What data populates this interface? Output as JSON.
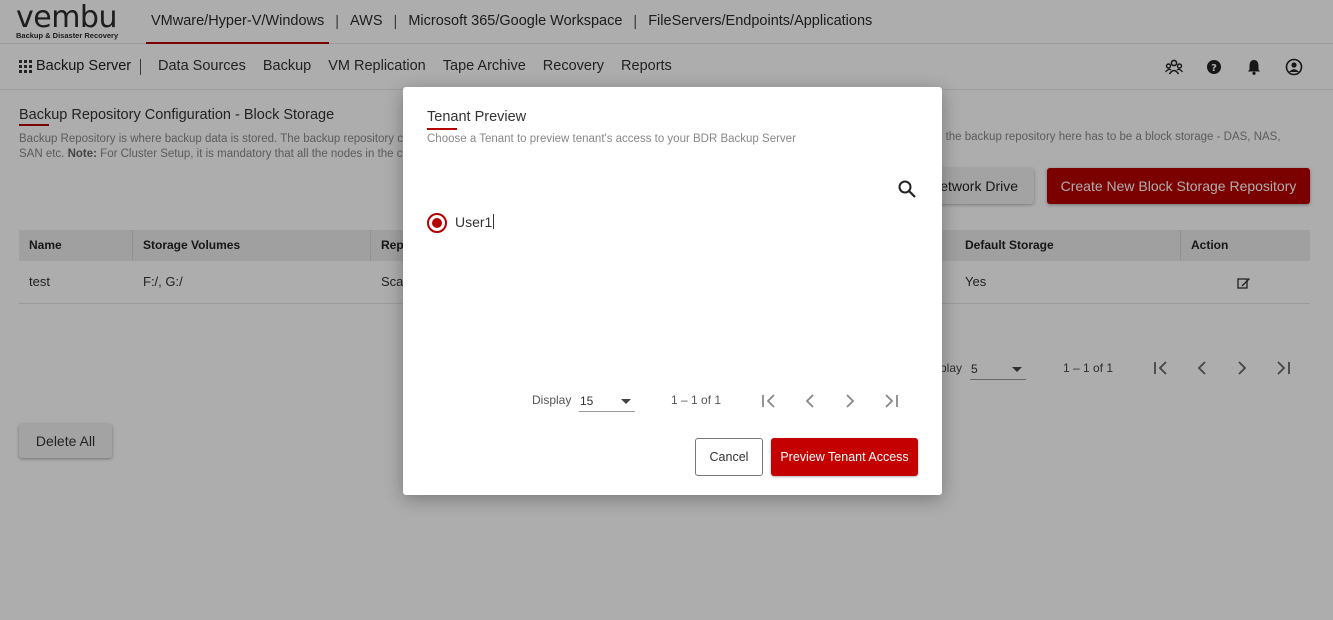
{
  "app": {
    "logo_text": "vembu",
    "logo_tagline": "Backup & Disaster Recovery"
  },
  "top_nav": {
    "items": [
      {
        "label": "VMware/Hyper-V/Windows",
        "active": true
      },
      {
        "label": "AWS"
      },
      {
        "label": "Microsoft 365/Google Workspace"
      },
      {
        "label": "FileServers/Endpoints/Applications"
      }
    ],
    "separator": "|"
  },
  "sub_nav": {
    "brand": "Backup Server",
    "items": [
      "Data Sources",
      "Backup",
      "VM Replication",
      "Tape Archive",
      "Recovery",
      "Reports"
    ],
    "icons": [
      "users-icon",
      "help-icon",
      "bell-icon",
      "user-profile-icon"
    ]
  },
  "page": {
    "title": "Backup Repository Configuration - Block Storage",
    "desc_line1": "Backup Repository is where backup data is stored. The backup repository c",
    "desc_line1_right": "eate the backup repository here has to be a block storage - DAS, NAS,",
    "desc_line2_prefix": "SAN etc. ",
    "desc_line2_bold": "Note:",
    "desc_line2_rest": " For Cluster Setup, it is mandatory that all the nodes in the c",
    "network_drive_button": "etwork Drive",
    "create_button": "Create New Block Storage Repository",
    "table": {
      "columns": [
        "Name",
        "Storage Volumes",
        "Repo",
        "Default Storage",
        "Action"
      ],
      "rows": [
        {
          "name": "test",
          "volumes": "F:/, G:/",
          "repo": "Scal",
          "default_storage": "Yes",
          "action_icon": "edit-icon"
        }
      ]
    },
    "pager": {
      "display_label": "play",
      "page_size": "5",
      "range": "1 – 1 of 1"
    },
    "delete_all_button": "Delete All"
  },
  "modal": {
    "title": "Tenant Preview",
    "subtitle": "Choose a Tenant to preview tenant's access to your BDR Backup Server",
    "search_icon": "search-icon",
    "tenants": [
      {
        "label": "User1",
        "selected": true
      }
    ],
    "pager": {
      "display_label": "Display",
      "page_size": "15",
      "range": "1 – 1 of 1"
    },
    "cancel_button": "Cancel",
    "preview_button": "Preview Tenant Access"
  },
  "colors": {
    "accent": "#b60000",
    "overlay": "rgba(0,0,0,0.32)"
  }
}
